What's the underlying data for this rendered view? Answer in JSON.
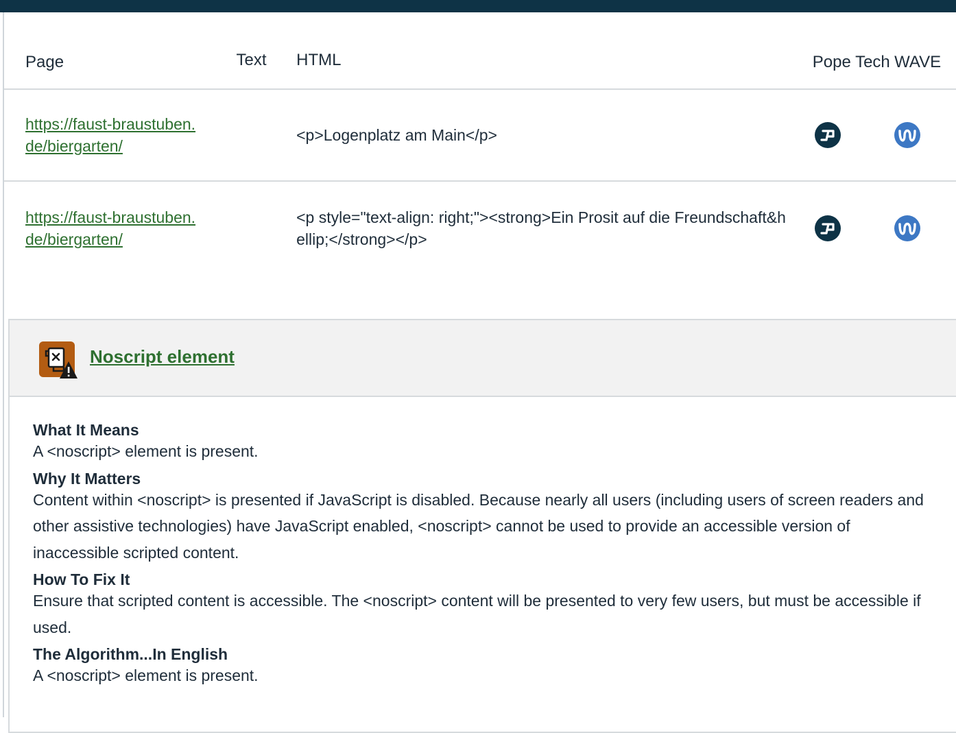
{
  "table": {
    "headers": {
      "page": "Page",
      "text": "Text",
      "html": "HTML",
      "pope": "Pope Tech",
      "wave": "WAVE"
    },
    "rows": [
      {
        "page": "https://faust-braustuben.de/biergarten/",
        "text": "",
        "html": "<p>Logenplatz am Main</p>"
      },
      {
        "page": "https://faust-braustuben.de/biergarten/",
        "text": "",
        "html": "<p style=\"text-align: right;\"><strong>Ein Prosit auf die Freundschaft&hellip;</strong></p>"
      }
    ]
  },
  "icons": {
    "pope": "pope-tech-icon",
    "wave": "wave-icon",
    "noscript": "noscript-alert-icon"
  },
  "colors": {
    "topbar": "#0e3346",
    "link": "#2e7030",
    "pope": "#0e3346",
    "wave": "#3d78c4",
    "noscript_icon": "#b35c12"
  },
  "panel": {
    "title": "Noscript element",
    "sections": [
      {
        "heading": "What It Means",
        "text": "A <noscript> element is present."
      },
      {
        "heading": "Why It Matters",
        "text": "Content within <noscript> is presented if JavaScript is disabled. Because nearly all users (including users of screen readers and other assistive technologies) have JavaScript enabled, <noscript> cannot be used to provide an accessible version of inaccessible scripted content."
      },
      {
        "heading": "How To Fix It",
        "text": "Ensure that scripted content is accessible. The <noscript> content will be presented to very few users, but must be accessible if used."
      },
      {
        "heading": "The Algorithm...In English",
        "text": "A <noscript> element is present."
      }
    ]
  }
}
